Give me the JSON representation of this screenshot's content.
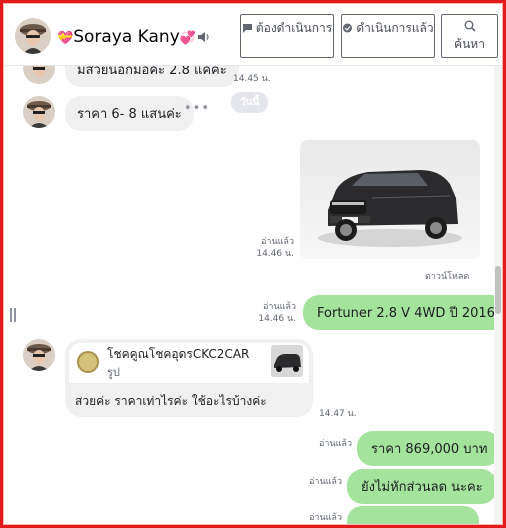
{
  "header": {
    "name": "Soraya Kany",
    "buttons": [
      {
        "label": "ต้องดำเนินการ"
      },
      {
        "label": "ดำเนินการแล้ว"
      },
      {
        "label": "ค้นหา"
      }
    ]
  },
  "messages": {
    "partial_top": {
      "text": "มีสวยนอกมือคะ 2.8 แคคะ",
      "time": "14.45 น."
    },
    "price_range": {
      "text": "ราคา 6- 8 แสนค่ะ"
    },
    "day_chip": "วันนี้",
    "photo_meta": {
      "read": "อ่านแล้ว",
      "time": "14.46 น."
    },
    "download": "ดาวน์โหลด",
    "fortuner": {
      "text": "Fortuner 2.8 V 4WD ปี 2016",
      "read": "อ่านแล้ว",
      "time": "14.46 น."
    },
    "share": {
      "title": "โชคคูณโชคอุดรCKC2CAR",
      "subtitle": "รูป",
      "text": "สวยค่ะ ราคาเท่าไรค่ะ ใช้อะไรบ้างค่ะ",
      "time": "14.47 น."
    },
    "price": {
      "text": "ราคา 869,000 บาท",
      "read": "อ่านแล้ว"
    },
    "no_discount": {
      "text": "ยังไม่หักส่วนลด นะคะ",
      "read": "อ่านแล้ว"
    },
    "partial_bottom": {
      "read": "อ่านแล้ว"
    }
  },
  "colors": {
    "frame": "#e21b1b",
    "outgoing_bubble": "#a4e39c",
    "incoming_bubble": "#f1f0f0"
  }
}
